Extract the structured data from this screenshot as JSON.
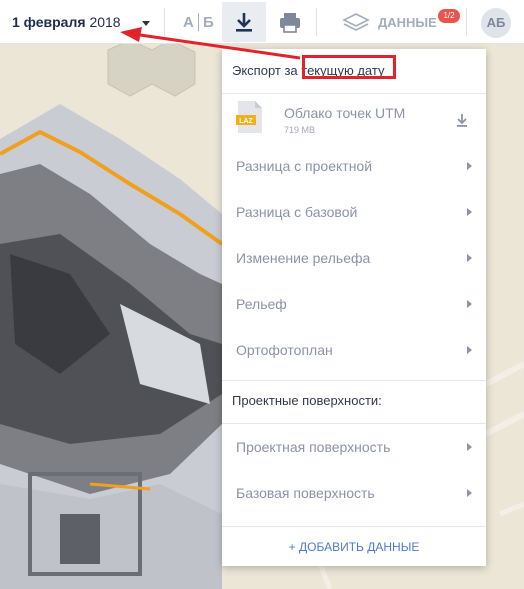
{
  "toolbar": {
    "date_day": "1 февраля",
    "date_year": "2018",
    "compare_a": "А",
    "compare_b": "Б",
    "data_label": "ДАННЫЕ",
    "data_badge": "1/2",
    "avatar_initials": "АБ"
  },
  "export_menu": {
    "header": "Экспорт за текущую дату",
    "point_cloud": {
      "badge": "LAZ",
      "title": "Облако точек UTM",
      "size": "719 МВ"
    },
    "items": [
      {
        "label": "Разница с проектной"
      },
      {
        "label": "Разница с базовой"
      },
      {
        "label": "Изменение рельефа"
      },
      {
        "label": "Рельеф"
      },
      {
        "label": "Ортофотоплан"
      }
    ],
    "section_title": "Проектные поверхности:",
    "project_items": [
      {
        "label": "Проектная поверхность"
      },
      {
        "label": "Базовая поверхность"
      }
    ],
    "add_data": "+ ДОБАВИТЬ ДАННЫЕ"
  },
  "colors": {
    "accent_blue": "#4d7bd0",
    "badge_red": "#e8544e",
    "annotation_red": "#e3232b",
    "laz_yellow": "#f2b01e",
    "boundary_orange": "#f0a020"
  },
  "icons": [
    "caret-down-icon",
    "download-icon",
    "printer-icon",
    "layers-icon",
    "laz-file-icon",
    "chevron-right-icon"
  ]
}
